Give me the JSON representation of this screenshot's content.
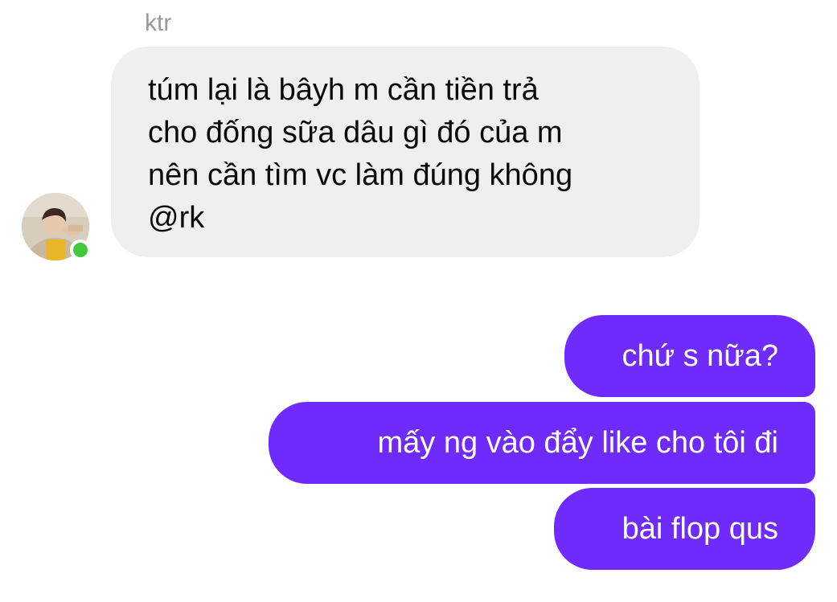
{
  "chat": {
    "sender_name": "ktr",
    "sender_online": true,
    "incoming_message": "túm lại là bâyh m cần tiền trả\ncho đống sữa dâu gì đó của m\nnên cần tìm vc làm đúng không\n@rk",
    "outgoing_messages": [
      "chứ s nữa?",
      "mấy ng vào đẩy like cho tôi đi",
      "bài flop qus"
    ]
  },
  "colors": {
    "incoming_bubble": "#efefef",
    "outgoing_bubble": "#6e2bfb",
    "online_indicator": "#3fc93b",
    "sender_name_text": "#9a9a9a"
  },
  "icons": {
    "avatar": "user-avatar-photo",
    "online": "online-status-dot"
  }
}
